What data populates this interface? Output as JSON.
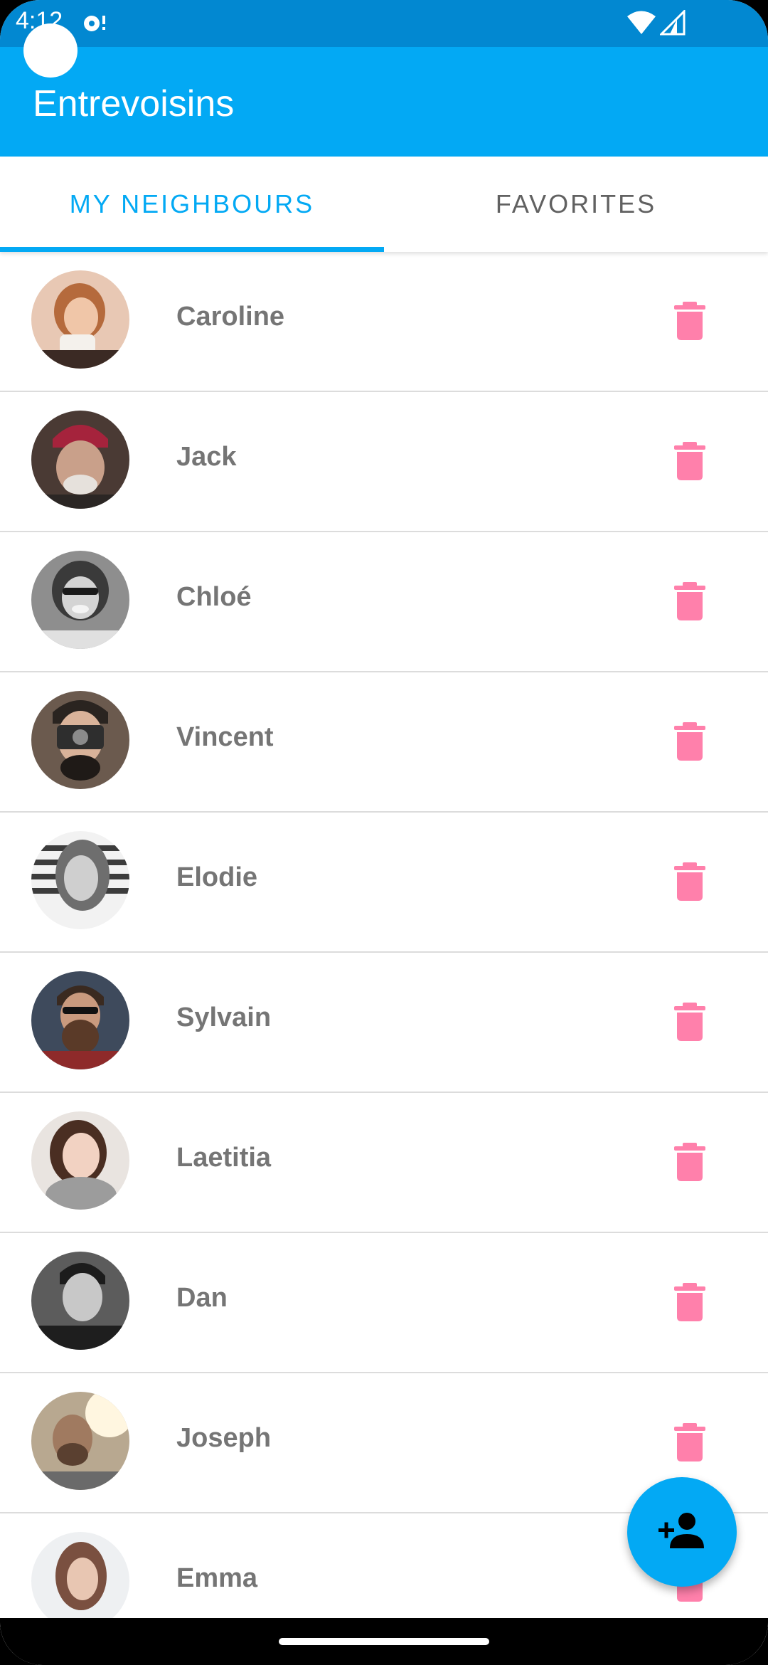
{
  "status_bar": {
    "time": "4:12"
  },
  "app_bar": {
    "title": "Entrevoisins"
  },
  "tabs": [
    {
      "label": "MY NEIGHBOURS",
      "selected": true
    },
    {
      "label": "FAVORITES",
      "selected": false
    }
  ],
  "neighbours": [
    {
      "name": "Caroline"
    },
    {
      "name": "Jack"
    },
    {
      "name": "Chloé"
    },
    {
      "name": "Vincent"
    },
    {
      "name": "Elodie"
    },
    {
      "name": "Sylvain"
    },
    {
      "name": "Laetitia"
    },
    {
      "name": "Dan"
    },
    {
      "name": "Joseph"
    },
    {
      "name": "Emma"
    }
  ],
  "icons": {
    "delete": "trash-icon",
    "fab": "person-add-icon"
  },
  "colors": {
    "primary": "#03a9f4",
    "primary_dark": "#0288d1",
    "delete": "#ff80ab",
    "name_text": "#757575"
  }
}
